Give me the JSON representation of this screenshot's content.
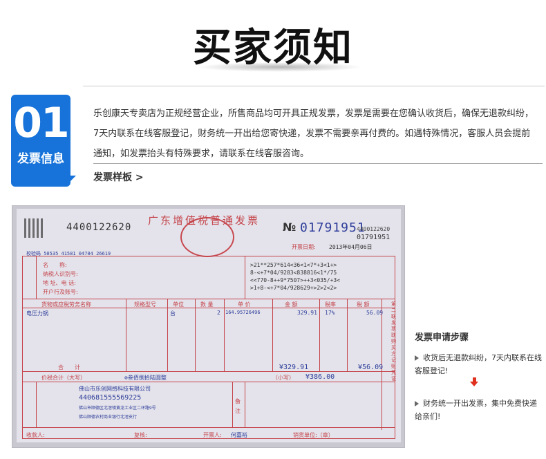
{
  "header": {
    "title": "买家须知"
  },
  "section": {
    "number": "01",
    "label": "发票信息",
    "paragraph": "乐创康天专卖店为正规经营企业，所售商品均可开具正规发票，发票是需要在您确认收货后，确保无退款纠纷，7天内联系在线客服登记，财务统一开出给您寄快递，发票不需要亲再付费的。如遇特殊情况，客服人员会提前通知，如发票抬头有特殊要求，请联系在线客服咨询。",
    "sample_label": "发票样板 >"
  },
  "invoice": {
    "code": "4400122620",
    "title": "广东增值税普通发票",
    "number_symbol": "№",
    "number": "01791951",
    "small_code": "4400122620",
    "small_number": "01791951",
    "date_label": "开票日期:",
    "date": "2013年04月06日",
    "check_code": "校验码 50535 41581 04704 26619",
    "buyer_labels": [
      "名　　称:",
      "纳税人识别号:",
      "地 址、电 话:",
      "开户行及账号:"
    ],
    "cipher": ">21**257*614<36<1<7*+3<1+>\n8-<+7*04/9283<838816<1*/75\n<<770-8++9*7507>++3<035/+3<\n>1+8-<+7*04/928629+>2>2<2>",
    "columns": [
      "货物或应税劳务名称",
      "规格型号",
      "单位",
      "数 量",
      "单 价",
      "金 额",
      "税率",
      "税 额"
    ],
    "row": {
      "name": "电压力锅",
      "unit": "台",
      "qty": "2",
      "price": "164.95726496",
      "amount": "329.91",
      "rate": "17%",
      "tax": "56.09"
    },
    "total_label": "合　　计",
    "total_amount": "¥329.91",
    "total_tax": "¥56.09",
    "grand_label": "价税合计（大写）",
    "grand_words": "⊗叁佰捌拾陆圆整",
    "grand_small_label": "（小写）",
    "grand_small": "¥386.00",
    "seller_name": "佛山市乐创网络科技有限公司",
    "seller_tax_id": "440681555569225",
    "seller_addr": "佛山市顺德区北滘镇黄龙工业区二环路9号",
    "seller_bank": "佛山顺德农村商业银行北滘支行",
    "remark_label": "备注",
    "payee_label": "收款人:",
    "review_label": "复核:",
    "issuer_label": "开票人:",
    "issuer": "何嘉裕",
    "seller_seal_label": "销货单位:（章）",
    "side_label": "第二联 发票联 购买方记账凭证"
  },
  "steps": {
    "title": "发票申请步骤",
    "items": [
      "收货后无退款纠纷，7天内联系在线客服登记!",
      "财务统一开出发票，集中免费快递给亲们!"
    ]
  },
  "colors": {
    "badge_blue": "#1773d9",
    "arrow_red": "#e0301e",
    "invoice_red": "#c5434a",
    "invoice_blue": "#2d3d9a"
  }
}
